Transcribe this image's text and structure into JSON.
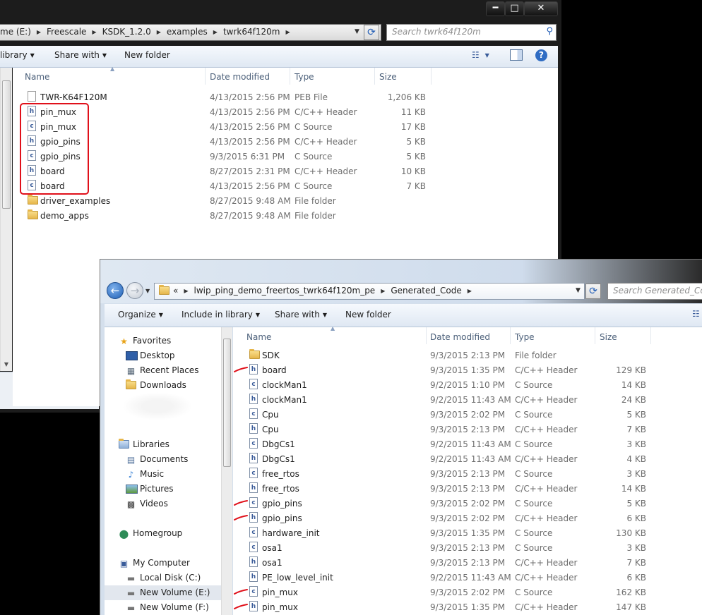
{
  "window1": {
    "controls": {
      "minimize": "━",
      "maximize": "□",
      "close": "✕"
    },
    "breadcrumb": [
      "me (E:)",
      "Freescale",
      "KSDK_1.2.0",
      "examples",
      "twrk64f120m"
    ],
    "search_placeholder": "Search twrk64f120m",
    "toolbar": {
      "library": "library",
      "share_with": "Share with",
      "new_folder": "New folder"
    },
    "columns": {
      "name": "Name",
      "date": "Date modified",
      "type": "Type",
      "size": "Size"
    },
    "files": [
      {
        "name": "TWR-K64F120M",
        "date": "4/13/2015 2:56 PM",
        "type": "PEB File",
        "size": "1,206 KB",
        "icon": "file-icon"
      },
      {
        "name": "pin_mux",
        "date": "4/13/2015 2:56 PM",
        "type": "C/C++ Header",
        "size": "11 KB",
        "icon": "h"
      },
      {
        "name": "pin_mux",
        "date": "4/13/2015 2:56 PM",
        "type": "C Source",
        "size": "17 KB",
        "icon": "c"
      },
      {
        "name": "gpio_pins",
        "date": "4/13/2015 2:56 PM",
        "type": "C/C++ Header",
        "size": "5 KB",
        "icon": "h"
      },
      {
        "name": "gpio_pins",
        "date": "9/3/2015 6:31 PM",
        "type": "C Source",
        "size": "5 KB",
        "icon": "c"
      },
      {
        "name": "board",
        "date": "8/27/2015 2:31 PM",
        "type": "C/C++ Header",
        "size": "10 KB",
        "icon": "h"
      },
      {
        "name": "board",
        "date": "4/13/2015 2:56 PM",
        "type": "C Source",
        "size": "7 KB",
        "icon": "c"
      },
      {
        "name": "driver_examples",
        "date": "8/27/2015 9:48 AM",
        "type": "File folder",
        "size": "",
        "icon": "folder"
      },
      {
        "name": "demo_apps",
        "date": "8/27/2015 9:48 AM",
        "type": "File folder",
        "size": "",
        "icon": "folder"
      }
    ]
  },
  "window2": {
    "breadcrumb": [
      "«",
      "lwip_ping_demo_freertos_twrk64f120m_pe",
      "Generated_Code"
    ],
    "search_placeholder": "Search Generated_Code",
    "toolbar": {
      "organize": "Organize",
      "include_in_library": "Include in library",
      "share_with": "Share with",
      "new_folder": "New folder"
    },
    "columns": {
      "name": "Name",
      "date": "Date modified",
      "type": "Type",
      "size": "Size"
    },
    "nav": {
      "favorites": {
        "label": "Favorites",
        "items": [
          "Desktop",
          "Recent Places",
          "Downloads"
        ]
      },
      "libraries": {
        "label": "Libraries",
        "items": [
          "Documents",
          "Music",
          "Pictures",
          "Videos"
        ]
      },
      "homegroup": "Homegroup",
      "computer": {
        "label": "My Computer",
        "items": [
          "Local Disk (C:)",
          "New Volume (E:)",
          "New Volume (F:)"
        ]
      }
    },
    "files": [
      {
        "name": "SDK",
        "date": "9/3/2015 2:13 PM",
        "type": "File folder",
        "size": "",
        "icon": "folder"
      },
      {
        "name": "board",
        "date": "9/3/2015 1:35 PM",
        "type": "C/C++ Header",
        "size": "129 KB",
        "icon": "h"
      },
      {
        "name": "clockMan1",
        "date": "9/2/2015 1:10 PM",
        "type": "C Source",
        "size": "14 KB",
        "icon": "c"
      },
      {
        "name": "clockMan1",
        "date": "9/2/2015 11:43 AM",
        "type": "C/C++ Header",
        "size": "24 KB",
        "icon": "h"
      },
      {
        "name": "Cpu",
        "date": "9/3/2015 2:02 PM",
        "type": "C Source",
        "size": "5 KB",
        "icon": "c"
      },
      {
        "name": "Cpu",
        "date": "9/3/2015 2:13 PM",
        "type": "C/C++ Header",
        "size": "7 KB",
        "icon": "h"
      },
      {
        "name": "DbgCs1",
        "date": "9/2/2015 11:43 AM",
        "type": "C Source",
        "size": "3 KB",
        "icon": "c"
      },
      {
        "name": "DbgCs1",
        "date": "9/2/2015 11:43 AM",
        "type": "C/C++ Header",
        "size": "4 KB",
        "icon": "h"
      },
      {
        "name": "free_rtos",
        "date": "9/3/2015 2:13 PM",
        "type": "C Source",
        "size": "3 KB",
        "icon": "c"
      },
      {
        "name": "free_rtos",
        "date": "9/3/2015 2:13 PM",
        "type": "C/C++ Header",
        "size": "14 KB",
        "icon": "h"
      },
      {
        "name": "gpio_pins",
        "date": "9/3/2015 2:02 PM",
        "type": "C Source",
        "size": "5 KB",
        "icon": "c"
      },
      {
        "name": "gpio_pins",
        "date": "9/3/2015 2:02 PM",
        "type": "C/C++ Header",
        "size": "6 KB",
        "icon": "h"
      },
      {
        "name": "hardware_init",
        "date": "9/3/2015 1:35 PM",
        "type": "C Source",
        "size": "130 KB",
        "icon": "c"
      },
      {
        "name": "osa1",
        "date": "9/3/2015 2:13 PM",
        "type": "C Source",
        "size": "3 KB",
        "icon": "c"
      },
      {
        "name": "osa1",
        "date": "9/3/2015 2:13 PM",
        "type": "C/C++ Header",
        "size": "7 KB",
        "icon": "h"
      },
      {
        "name": "PE_low_level_init",
        "date": "9/2/2015 11:43 AM",
        "type": "C/C++ Header",
        "size": "6 KB",
        "icon": "h"
      },
      {
        "name": "pin_mux",
        "date": "9/3/2015 2:02 PM",
        "type": "C Source",
        "size": "162 KB",
        "icon": "c"
      },
      {
        "name": "pin_mux",
        "date": "9/3/2015 1:35 PM",
        "type": "C/C++ Header",
        "size": "147 KB",
        "icon": "h"
      }
    ],
    "annotated_rows": [
      1,
      10,
      11,
      16,
      17
    ]
  },
  "colors": {
    "annotation_red": "#e0101a",
    "header_text": "#4c607a",
    "link_blue": "#1e5bb5"
  }
}
